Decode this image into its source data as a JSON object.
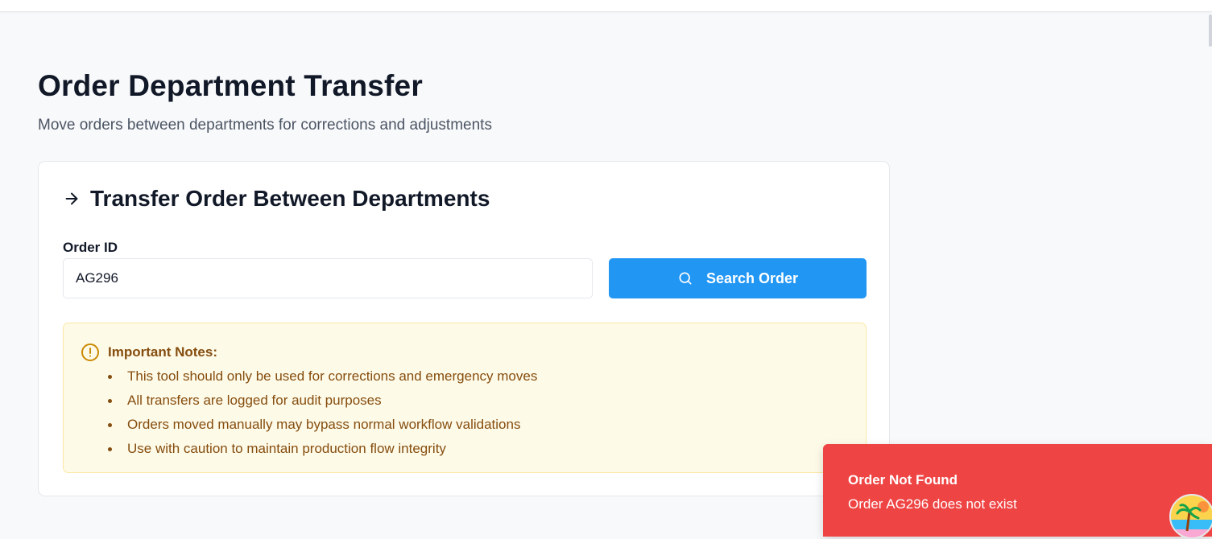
{
  "page": {
    "title": "Order Department Transfer",
    "subtitle": "Move orders between departments for corrections and adjustments"
  },
  "card": {
    "title": "Transfer Order Between Departments",
    "title_icon": "arrow-right-icon",
    "order_id_label": "Order ID",
    "order_id_value": "AG296",
    "search_button_label": "Search Order",
    "search_icon": "search-icon"
  },
  "notes": {
    "icon": "alert-circle-icon",
    "title": "Important Notes:",
    "items": [
      "This tool should only be used for corrections and emergency moves",
      "All transfers are logged for audit purposes",
      "Orders moved manually may bypass normal workflow validations",
      "Use with caution to maintain production flow integrity"
    ]
  },
  "toast": {
    "title": "Order Not Found",
    "message": "Order AG296 does not exist",
    "color": "#ef4444"
  },
  "colors": {
    "primary": "#2196f3",
    "warning_bg": "#fefae8",
    "warning_text": "#854d0e",
    "error": "#ef4444"
  }
}
